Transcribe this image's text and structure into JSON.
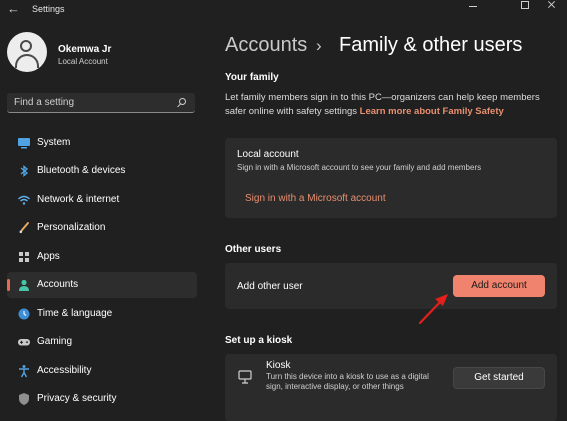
{
  "window": {
    "title": "Settings"
  },
  "user": {
    "name": "Okemwa Jr",
    "account_type": "Local Account"
  },
  "search": {
    "placeholder": "Find a setting"
  },
  "sidebar": {
    "items": [
      {
        "label": "System",
        "icon": "monitor-icon",
        "active": false
      },
      {
        "label": "Bluetooth & devices",
        "icon": "bluetooth-icon",
        "active": false
      },
      {
        "label": "Network & internet",
        "icon": "wifi-icon",
        "active": false
      },
      {
        "label": "Personalization",
        "icon": "brush-icon",
        "active": false
      },
      {
        "label": "Apps",
        "icon": "apps-icon",
        "active": false
      },
      {
        "label": "Accounts",
        "icon": "person-icon",
        "active": true
      },
      {
        "label": "Time & language",
        "icon": "globe-clock-icon",
        "active": false
      },
      {
        "label": "Gaming",
        "icon": "gamepad-icon",
        "active": false
      },
      {
        "label": "Accessibility",
        "icon": "accessibility-icon",
        "active": false
      },
      {
        "label": "Privacy & security",
        "icon": "shield-icon",
        "active": false
      }
    ]
  },
  "breadcrumb": {
    "parent": "Accounts",
    "separator": "›",
    "current": "Family & other users"
  },
  "your_family": {
    "heading": "Your family",
    "description": "Let family members sign in to this PC—organizers can help keep members safer online with safety settings",
    "link": "Learn more about Family Safety"
  },
  "local_account": {
    "title": "Local account",
    "description": "Sign in with a Microsoft account to see your family and add members",
    "signin_link": "Sign in with a Microsoft account"
  },
  "other_users": {
    "heading": "Other users",
    "add_label": "Add other user",
    "button": "Add account"
  },
  "kiosk": {
    "heading": "Set up a kiosk",
    "title": "Kiosk",
    "description": "Turn this device into a kiosk to use as a digital sign, interactive display, or other things",
    "button": "Get started"
  },
  "colors": {
    "accent": "#f0836e",
    "link": "#e98f6f",
    "background": "#202020",
    "card": "#2b2b2b",
    "annotation_arrow": "#e3201b"
  }
}
